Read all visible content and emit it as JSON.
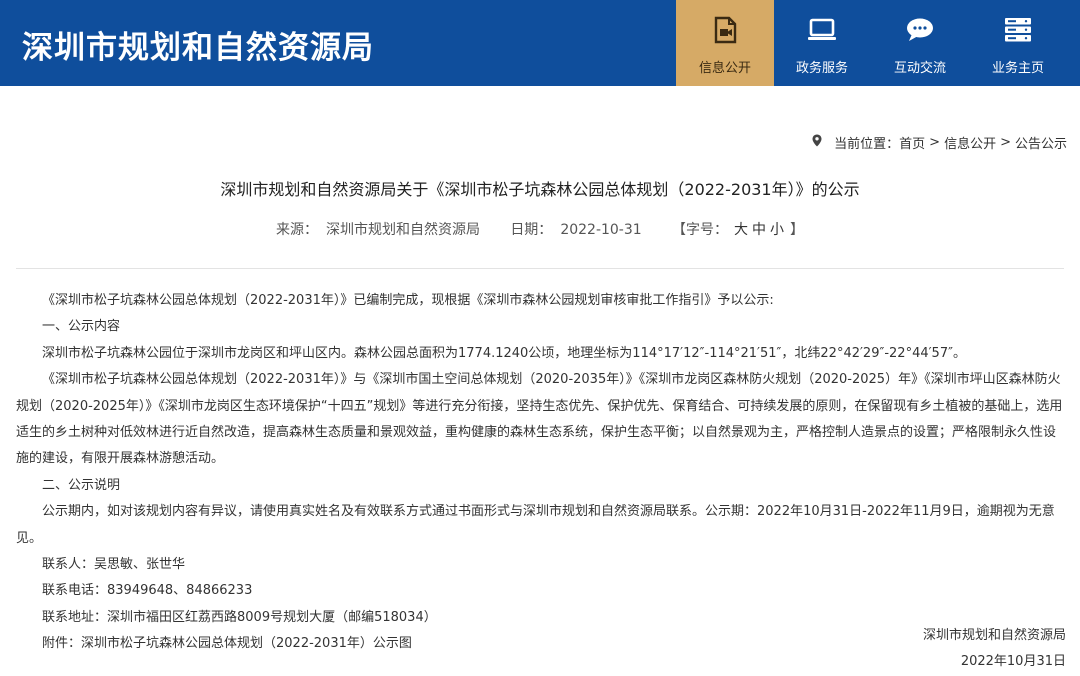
{
  "header": {
    "site_title": "深圳市规划和自然资源局",
    "nav": [
      {
        "label": "信息公开",
        "icon": "document-video-icon"
      },
      {
        "label": "政务服务",
        "icon": "monitor-icon"
      },
      {
        "label": "互动交流",
        "icon": "chat-bubble-icon"
      },
      {
        "label": "业务主页",
        "icon": "server-icon"
      }
    ]
  },
  "breadcrumb": {
    "prefix": "当前位置：",
    "items": [
      "首页",
      "信息公开",
      "公告公示"
    ],
    "separator": ">"
  },
  "article": {
    "title": "深圳市规划和自然资源局关于《深圳市松子坑森林公园总体规划（2022-2031年）》的公示",
    "meta": {
      "source_label": "来源：",
      "source": "深圳市规划和自然资源局",
      "date_label": "日期：",
      "date": "2022-10-31",
      "font_label": "【字号：",
      "font_large": "大",
      "font_medium": "中",
      "font_small": "小",
      "font_close": "】"
    },
    "paragraphs": [
      "《深圳市松子坑森林公园总体规划（2022-2031年）》已编制完成，现根据《深圳市森林公园规划审核审批工作指引》予以公示:",
      "一、公示内容",
      "深圳市松子坑森林公园位于深圳市龙岗区和坪山区内。森林公园总面积为1774.1240公顷，地理坐标为114°17′12″-114°21′51″，北纬22°42′29″-22°44′57″。",
      "《深圳市松子坑森林公园总体规划（2022-2031年）》与《深圳市国土空间总体规划（2020-2035年）》《深圳市龙岗区森林防火规划（2020-2025）年》《深圳市坪山区森林防火规划（2020-2025年）》《深圳市龙岗区生态环境保护“十四五”规划》等进行充分衔接，坚持生态优先、保护优先、保育结合、可持续发展的原则，在保留现有乡土植被的基础上，选用适生的乡土树种对低效林进行近自然改造，提高森林生态质量和景观效益，重构健康的森林生态系统，保护生态平衡；以自然景观为主，严格控制人造景点的设置；严格限制永久性设施的建设，有限开展森林游憩活动。",
      "二、公示说明",
      "公示期内，如对该规划内容有异议，请使用真实姓名及有效联系方式通过书面形式与深圳市规划和自然资源局联系。公示期：2022年10月31日-2022年11月9日，逾期视为无意见。",
      "联系人：吴思敏、张世华",
      "联系电话：83949648、84866233",
      "联系地址：深圳市福田区红荔西路8009号规划大厦（邮编518034）",
      "附件：深圳市松子坑森林公园总体规划（2022-2031年）公示图"
    ],
    "signature_org": "深圳市规划和自然资源局",
    "signature_date": "2022年10月31日"
  },
  "colors": {
    "header_bg": "#0f4e9c",
    "active_tab_bg": "#d6aa66"
  }
}
